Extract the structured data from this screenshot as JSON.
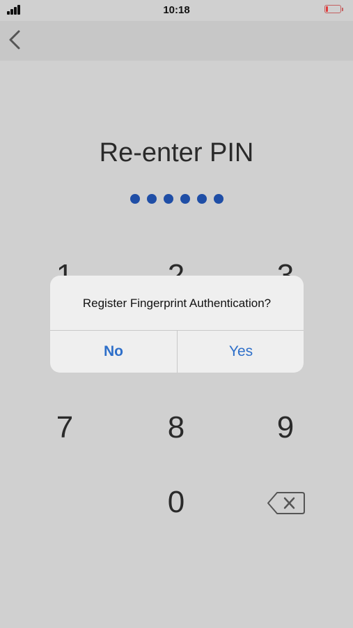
{
  "status": {
    "time": "10:18",
    "battery_color": "#e23b3b"
  },
  "nav": {
    "back_icon": "chevron-left-icon"
  },
  "pin": {
    "title": "Re-enter PIN",
    "dot_count": 6,
    "dot_color": "#1f4ea6"
  },
  "keypad": {
    "row1": [
      "1",
      "2",
      "3"
    ],
    "row3": [
      "7",
      "8",
      "9"
    ],
    "zero": "0",
    "backspace_icon": "backspace-icon"
  },
  "dialog": {
    "message": "Register Fingerprint Authentication?",
    "no_label": "No",
    "yes_label": "Yes",
    "accent": "#2e6fc9"
  }
}
